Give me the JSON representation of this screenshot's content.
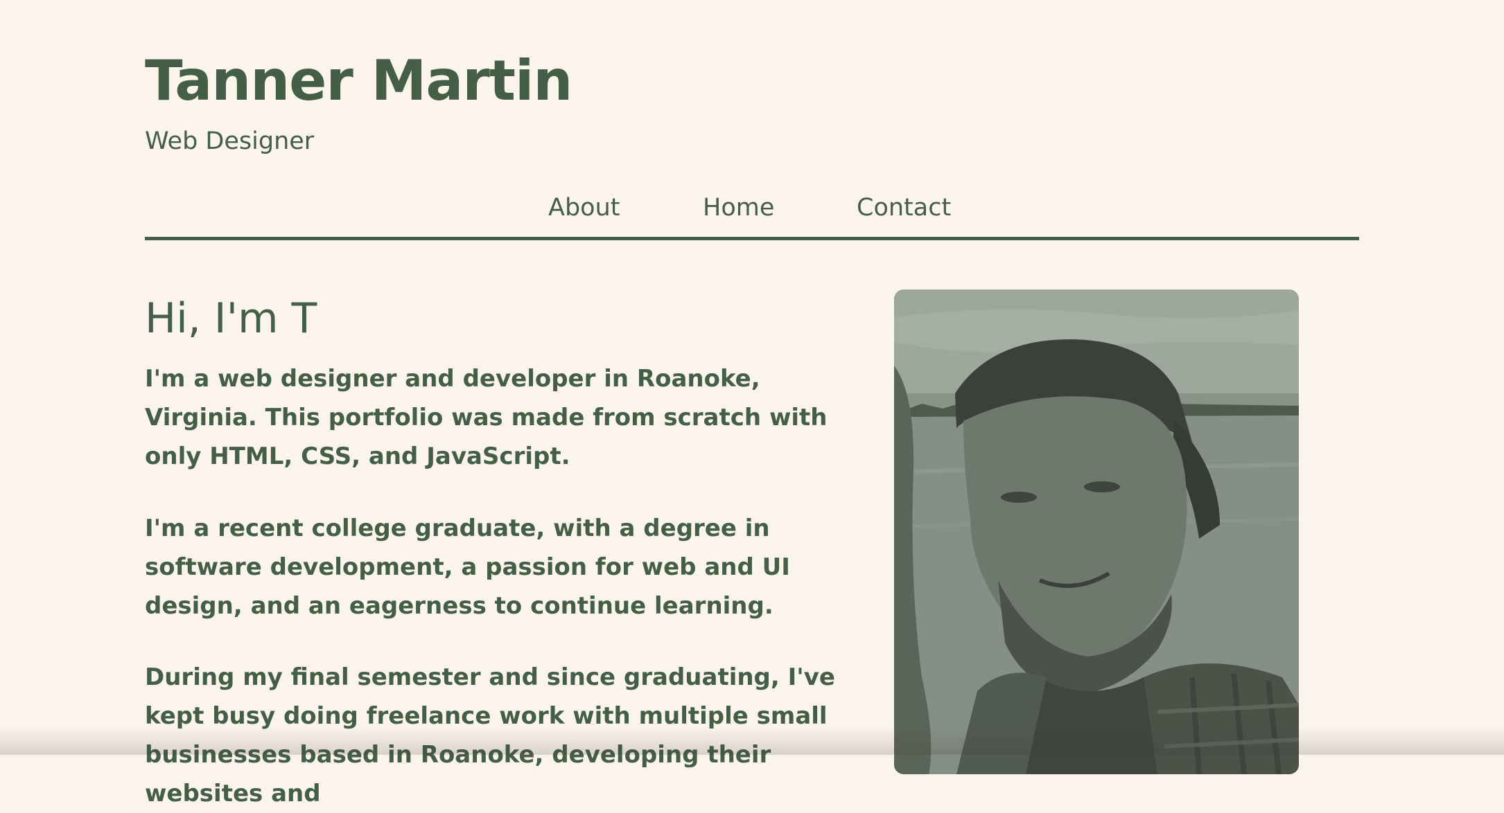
{
  "header": {
    "name": "Tanner Martin",
    "subtitle": "Web Designer"
  },
  "nav": {
    "items": [
      {
        "label": "About"
      },
      {
        "label": "Home"
      },
      {
        "label": "Contact"
      }
    ]
  },
  "intro": {
    "greeting": "Hi, I'm T",
    "paragraphs": [
      "I'm a web designer and developer in Roanoke, Virginia. This portfolio was made from scratch with only HTML, CSS, and JavaScript.",
      "I'm a recent college graduate, with a degree in software development, a passion for web and UI design, and an eagerness to continue learning.",
      "During my final semester and since graduating, I've kept busy doing freelance work with multiple small businesses based in Roanoke, developing their websites and"
    ]
  },
  "colors": {
    "background": "#fbf4ea",
    "accent": "#455e47"
  }
}
